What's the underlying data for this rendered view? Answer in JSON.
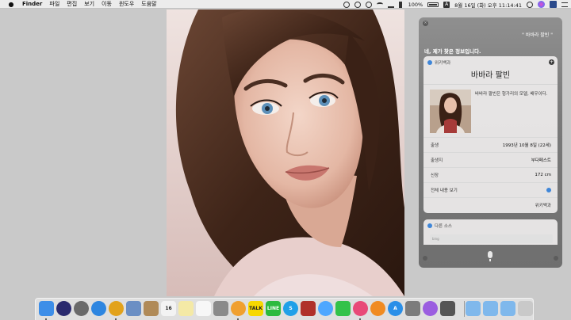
{
  "menubar": {
    "app": "Finder",
    "items": [
      "파일",
      "편집",
      "보기",
      "이동",
      "윈도우",
      "도움말"
    ],
    "battery": "100%",
    "input_source": "A",
    "datetime": "8월 16일 (화) 오후 11:14:41"
  },
  "siri": {
    "query": "\" 바바라 팔빈 \"",
    "answer": "네, 제가 찾은 정보입니다.",
    "card": {
      "source": "위키백과",
      "title": "바바라 팔빈",
      "description": "바바라 팔빈은 헝가리의 모델, 배우이다.",
      "facts": [
        {
          "label": "출생",
          "value": "1993년 10월 8일 (22세)"
        },
        {
          "label": "출생지",
          "value": "부다페스트"
        },
        {
          "label": "신장",
          "value": "172 cm"
        }
      ],
      "more_label": "전체 내용 보기",
      "footer": "위키백과"
    },
    "other_source": {
      "label": "다른 소스",
      "bing": "bing"
    }
  },
  "dock": {
    "icons": [
      {
        "name": "finder-icon",
        "color": "#3d8ee8",
        "label": ""
      },
      {
        "name": "siri-icon",
        "color": "#2a2a6e",
        "label": ""
      },
      {
        "name": "launchpad-icon",
        "color": "#6a6a6a",
        "label": ""
      },
      {
        "name": "safari-icon",
        "color": "#2e86e0",
        "label": ""
      },
      {
        "name": "chrome-icon",
        "color": "#e2a21b",
        "label": ""
      },
      {
        "name": "preview-icon",
        "color": "#6b8fc4",
        "label": ""
      },
      {
        "name": "contacts-icon",
        "color": "#b08a58",
        "label": ""
      },
      {
        "name": "calendar-icon",
        "color": "#f3f3f3",
        "label": "16"
      },
      {
        "name": "notes-icon",
        "color": "#f4e9a6",
        "label": ""
      },
      {
        "name": "reminders-icon",
        "color": "#f7f7f7",
        "label": ""
      },
      {
        "name": "keynote-icon",
        "color": "#8a8a8a",
        "label": ""
      },
      {
        "name": "photos-icon",
        "color": "#f0a030",
        "label": ""
      },
      {
        "name": "kakaotalk-icon",
        "color": "#f7d800",
        "label": "TALK"
      },
      {
        "name": "line-icon",
        "color": "#2dba3e",
        "label": "LINE"
      },
      {
        "name": "skype-icon",
        "color": "#1fa0e8",
        "label": "S"
      },
      {
        "name": "photo-booth-icon",
        "color": "#b0302a",
        "label": ""
      },
      {
        "name": "messages-icon",
        "color": "#4da7ff",
        "label": ""
      },
      {
        "name": "facetime-icon",
        "color": "#33c24a",
        "label": ""
      },
      {
        "name": "itunes-icon",
        "color": "#e84a78",
        "label": ""
      },
      {
        "name": "ibooks-icon",
        "color": "#f08b22",
        "label": ""
      },
      {
        "name": "app-store-icon",
        "color": "#2a8fe8",
        "label": "A"
      },
      {
        "name": "system-preferences-icon",
        "color": "#7c7c7c",
        "label": ""
      },
      {
        "name": "podcasts-icon",
        "color": "#9b5ee0",
        "label": ""
      },
      {
        "name": "activity-monitor-icon",
        "color": "#555555",
        "label": ""
      },
      {
        "name": "applications-folder-icon",
        "color": "#7fb8ec",
        "label": ""
      },
      {
        "name": "documents-folder-icon",
        "color": "#7fb8ec",
        "label": ""
      },
      {
        "name": "downloads-folder-icon",
        "color": "#7fb8ec",
        "label": ""
      },
      {
        "name": "trash-icon",
        "color": "#c9c9c9",
        "label": ""
      }
    ]
  }
}
